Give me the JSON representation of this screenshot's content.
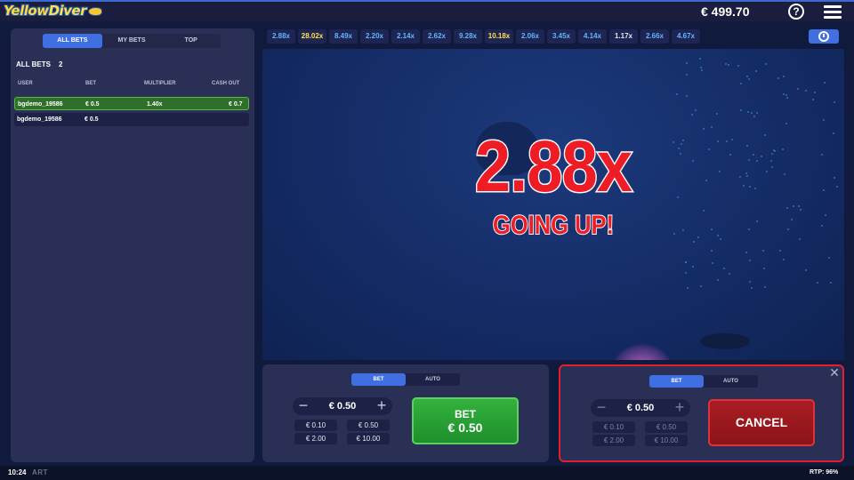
{
  "header": {
    "logo_text_1": "Yellow",
    "logo_text_2": "Diver",
    "balance": "€ 499.70",
    "help_label": "?"
  },
  "sidebar": {
    "tabs": [
      "ALL BETS",
      "MY BETS",
      "TOP"
    ],
    "active_tab": "ALL BETS",
    "title": "ALL BETS",
    "count": "2",
    "columns": [
      "USER",
      "BET",
      "MULTIPLIER",
      "CASH OUT"
    ],
    "rows": [
      {
        "user": "bgdemo_19586",
        "bet": "€ 0.5",
        "multiplier": "1.40x",
        "cashout": "€ 0.7",
        "status": "won"
      },
      {
        "user": "bgdemo_19586",
        "bet": "€ 0.5",
        "multiplier": "",
        "cashout": "",
        "status": "pending"
      }
    ]
  },
  "history": {
    "multipliers": [
      "2.88x",
      "28.02x",
      "8.49x",
      "2.20x",
      "2.14x",
      "2.62x",
      "9.28x",
      "10.18x",
      "2.06x",
      "3.45x",
      "4.14x",
      "1.17x",
      "2.66x",
      "4.67x"
    ],
    "colors": [
      "blue",
      "gold",
      "blue",
      "blue",
      "blue",
      "blue",
      "blue",
      "gold",
      "blue",
      "blue",
      "blue",
      "white",
      "blue",
      "blue"
    ]
  },
  "game": {
    "multiplier": "2.88x",
    "status": "GOING UP!"
  },
  "bet_panel_1": {
    "tabs": [
      "BET",
      "AUTO"
    ],
    "amount": "€ 0.50",
    "quick_amounts": [
      "€ 0.10",
      "€ 0.50",
      "€ 2.00",
      "€ 10.00"
    ],
    "button_line1": "BET",
    "button_line2": "€ 0.50"
  },
  "bet_panel_2": {
    "tabs": [
      "BET",
      "AUTO"
    ],
    "amount": "€ 0.50",
    "quick_amounts": [
      "€ 0.10",
      "€ 0.50",
      "€ 2.00",
      "€ 10.00"
    ],
    "button_label": "CANCEL",
    "close_label": "✕"
  },
  "footer": {
    "time": "10:24",
    "brand": "ART",
    "rtp": "RTP: 96%"
  },
  "colors": {
    "accent": "#3f6fe0",
    "multiplier_red": "#ee1c24",
    "bet_green": "#2ea83a",
    "cancel_red": "#a81d22"
  }
}
